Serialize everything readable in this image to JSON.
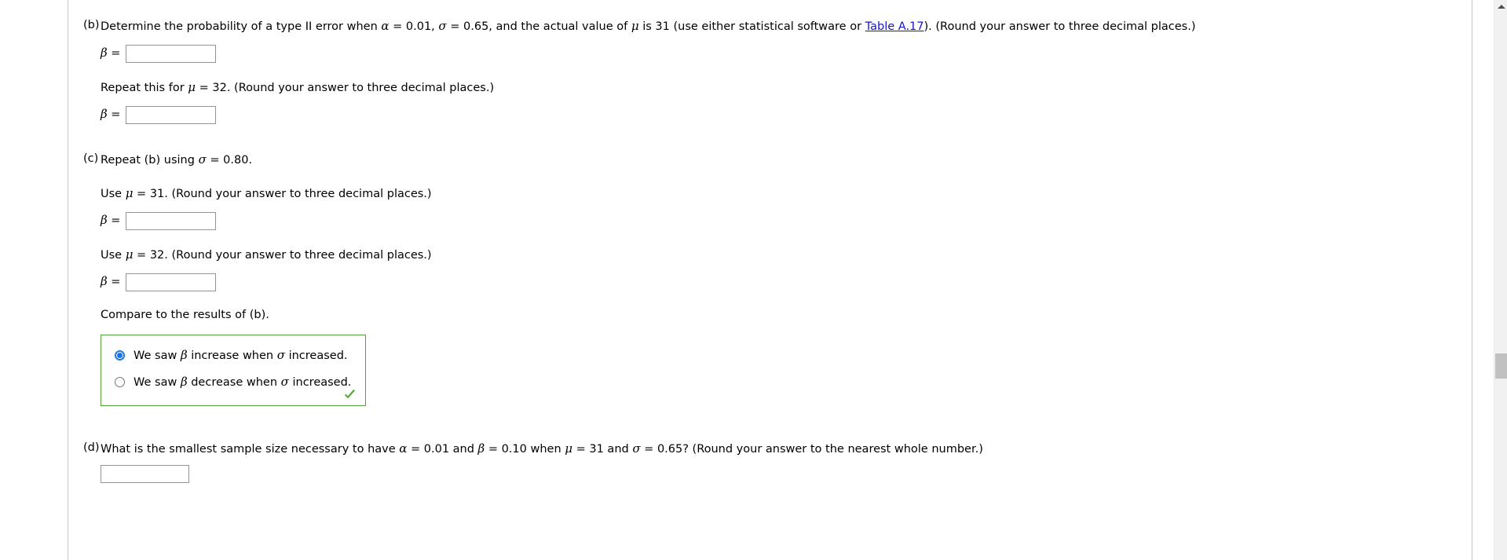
{
  "document": {
    "type": "homework-question",
    "scrollbar": {
      "position_percent": 63
    }
  },
  "parts": [
    {
      "id": "b",
      "label": "(b)",
      "prompt_segments": [
        {
          "text": "Determine the probability of a type II error when "
        },
        {
          "text": "α",
          "style": "math"
        },
        {
          "text": " = 0.01, "
        },
        {
          "text": "σ",
          "style": "math"
        },
        {
          "text": " = 0.65, and the actual value of "
        },
        {
          "text": "μ",
          "style": "math"
        },
        {
          "text": " is 31 (use either statistical software or "
        },
        {
          "text": "Table A.17",
          "style": "link"
        },
        {
          "text": "). (Round your answer to three decimal places.)"
        }
      ],
      "prompt_plain": "Determine the probability of a type II error when α = 0.01, σ = 0.65, and the actual value of μ is 31 (use either statistical software or Table A.17). (Round your answer to three decimal places.)",
      "link_text": "Table A.17",
      "answer1": {
        "symbol": "β",
        "equals": "=",
        "value": "",
        "placeholder": ""
      },
      "subprompt": "Repeat this for μ = 32. (Round your answer to three decimal places.)",
      "subprompt_segments": [
        {
          "text": "Repeat this for "
        },
        {
          "text": "μ",
          "style": "math"
        },
        {
          "text": " = 32. (Round your answer to three decimal places.)"
        }
      ],
      "answer2": {
        "symbol": "β",
        "equals": "=",
        "value": "",
        "placeholder": ""
      }
    },
    {
      "id": "c",
      "label": "(c)",
      "prompt_segments": [
        {
          "text": "Repeat (b) using "
        },
        {
          "text": "σ",
          "style": "math"
        },
        {
          "text": " = 0.80."
        }
      ],
      "prompt_plain": "Repeat (b) using σ = 0.80.",
      "sub1": {
        "text_segments": [
          {
            "text": "Use "
          },
          {
            "text": "μ",
            "style": "math"
          },
          {
            "text": " = 31. (Round your answer to three decimal places.)"
          }
        ],
        "text_plain": "Use μ = 31. (Round your answer to three decimal places.)",
        "answer": {
          "symbol": "β",
          "equals": "=",
          "value": "",
          "placeholder": ""
        }
      },
      "sub2": {
        "text_segments": [
          {
            "text": "Use "
          },
          {
            "text": "μ",
            "style": "math"
          },
          {
            "text": " = 32. (Round your answer to three decimal places.)"
          }
        ],
        "text_plain": "Use μ = 32. (Round your answer to three decimal places.)",
        "answer": {
          "symbol": "β",
          "equals": "=",
          "value": "",
          "placeholder": ""
        }
      },
      "compare_text": "Compare to the results of (b).",
      "choice_group": {
        "border_color": "#5a9e3a",
        "status": "correct",
        "status_icon": "green-checkmark",
        "options": [
          {
            "id": "increase",
            "selected": true,
            "segments": [
              {
                "text": "We saw "
              },
              {
                "text": "β",
                "style": "math"
              },
              {
                "text": " increase when "
              },
              {
                "text": "σ",
                "style": "math"
              },
              {
                "text": " increased."
              }
            ],
            "label_plain": "We saw β increase when σ increased."
          },
          {
            "id": "decrease",
            "selected": false,
            "segments": [
              {
                "text": "We saw "
              },
              {
                "text": "β",
                "style": "math"
              },
              {
                "text": " decrease when "
              },
              {
                "text": "σ",
                "style": "math"
              },
              {
                "text": " increased."
              }
            ],
            "label_plain": "We saw β decrease when σ increased."
          }
        ]
      }
    },
    {
      "id": "d",
      "label": "(d)",
      "prompt_segments": [
        {
          "text": "What is the smallest sample size necessary to have "
        },
        {
          "text": "α",
          "style": "math"
        },
        {
          "text": " = 0.01 and "
        },
        {
          "text": "β",
          "style": "math"
        },
        {
          "text": " = 0.10 when "
        },
        {
          "text": "μ",
          "style": "math"
        },
        {
          "text": " = 31 and "
        },
        {
          "text": "σ",
          "style": "math"
        },
        {
          "text": " = 0.65? (Round your answer to the nearest whole number.)"
        }
      ],
      "prompt_plain": "What is the smallest sample size necessary to have α = 0.01 and β = 0.10 when μ = 31 and σ = 0.65? (Round your answer to the nearest whole number.)",
      "answer": {
        "symbol": "",
        "equals": "",
        "value": "",
        "placeholder": ""
      }
    }
  ],
  "colors": {
    "link": "#1414cc",
    "correct_border": "#5a9e3a",
    "checkmark": "#57a83a",
    "radio_selected": "#1a73e8",
    "input_border": "#949494",
    "scrollbar_track": "#f1f1f1",
    "scrollbar_thumb": "#c1c1c1"
  }
}
